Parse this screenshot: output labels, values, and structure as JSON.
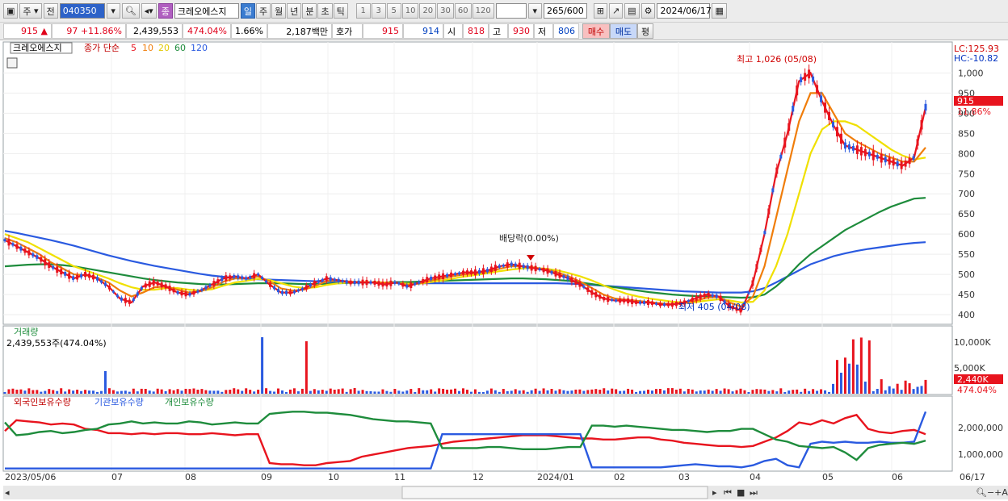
{
  "toolbar": {
    "period_unit": "주",
    "prev_label": "전",
    "code": "040350",
    "name_badge": "종",
    "name": "크레오에스지",
    "period_buttons": [
      "일",
      "주",
      "월",
      "년",
      "분",
      "초",
      "틱"
    ],
    "period_selected": "일",
    "num_buttons": [
      "1",
      "3",
      "5",
      "10",
      "20",
      "30",
      "60",
      "120"
    ],
    "count_display": "265/600",
    "date": "2024/06/17"
  },
  "quote": {
    "price": "915",
    "change": "97 +11.86%",
    "volume": "2,439,553",
    "volume_ratio": "474.04%",
    "turnover": "1.66%",
    "amount": "2,187백만",
    "hoga_label": "호가",
    "ask": "915",
    "bid": "914",
    "open_label": "시",
    "open": "818",
    "high_label": "고",
    "high": "930",
    "low_label": "저",
    "low": "806",
    "buy_label": "매수",
    "sell_label": "매도",
    "eval_label": "평"
  },
  "chart_data": [
    {
      "type": "line",
      "title": "크레오에스지",
      "subtitle": "종가 단순",
      "legend": [
        "5",
        "10",
        "20",
        "60",
        "120"
      ],
      "x_ticks": [
        "2023/05/06",
        "07",
        "08",
        "09",
        "10",
        "11",
        "12",
        "2024/01",
        "02",
        "03",
        "04",
        "05",
        "06",
        "06/17"
      ],
      "y_ticks": [
        400,
        450,
        500,
        550,
        600,
        650,
        700,
        750,
        800,
        850,
        900,
        950,
        1000
      ],
      "ylim": [
        380,
        1045
      ],
      "last_price": 915,
      "last_change": "11.86%",
      "lc_label": "LC:125.93",
      "hc_label": "HC:-10.82",
      "high_annotation": "최고 1,026 (05/08)",
      "low_annotation": "최저 405 (04/08)",
      "dividend_annotation": "배당락(0.00%)",
      "series": [
        {
          "name": "5",
          "color": "#e8141e",
          "values": [
            585,
            570,
            555,
            540,
            520,
            505,
            490,
            500,
            490,
            470,
            440,
            430,
            470,
            480,
            470,
            455,
            450,
            460,
            475,
            490,
            495,
            490,
            500,
            475,
            455,
            455,
            465,
            480,
            490,
            485,
            480,
            480,
            480,
            475,
            480,
            470,
            480,
            490,
            495,
            500,
            505,
            505,
            510,
            520,
            525,
            520,
            515,
            510,
            500,
            490,
            475,
            455,
            440,
            435,
            435,
            430,
            430,
            425,
            425,
            430,
            440,
            450,
            445,
            420,
            410,
            480,
            600,
            750,
            850,
            980,
            1000,
            930,
            870,
            820,
            810,
            800,
            790,
            780,
            770,
            790,
            915
          ]
        },
        {
          "name": "10",
          "color": "#f07d0a",
          "values": [
            590,
            580,
            565,
            550,
            530,
            515,
            500,
            498,
            492,
            480,
            460,
            445,
            455,
            468,
            470,
            462,
            455,
            458,
            468,
            482,
            490,
            490,
            495,
            483,
            465,
            460,
            462,
            472,
            484,
            485,
            482,
            481,
            480,
            478,
            479,
            474,
            477,
            485,
            490,
            496,
            500,
            503,
            506,
            514,
            520,
            520,
            517,
            512,
            505,
            495,
            482,
            466,
            450,
            440,
            437,
            434,
            431,
            428,
            426,
            428,
            434,
            442,
            444,
            430,
            420,
            445,
            520,
            640,
            760,
            880,
            950,
            950,
            900,
            850,
            830,
            815,
            800,
            790,
            780,
            780,
            815
          ]
        },
        {
          "name": "20",
          "color": "#f0e000",
          "values": [
            600,
            590,
            580,
            565,
            550,
            535,
            520,
            510,
            500,
            490,
            478,
            468,
            462,
            462,
            466,
            466,
            462,
            460,
            463,
            472,
            480,
            484,
            489,
            486,
            478,
            470,
            466,
            468,
            474,
            478,
            480,
            481,
            481,
            480,
            479,
            477,
            477,
            481,
            485,
            490,
            495,
            499,
            503,
            508,
            512,
            515,
            516,
            514,
            510,
            503,
            495,
            485,
            473,
            462,
            452,
            445,
            440,
            436,
            432,
            430,
            431,
            435,
            438,
            435,
            430,
            432,
            460,
            520,
            600,
            700,
            800,
            860,
            880,
            880,
            870,
            850,
            830,
            810,
            795,
            785,
            790
          ]
        },
        {
          "name": "60",
          "color": "#1e8c3c",
          "values": [
            520,
            522,
            524,
            525,
            525,
            523,
            520,
            515,
            510,
            505,
            500,
            495,
            490,
            486,
            483,
            480,
            478,
            476,
            475,
            475,
            476,
            477,
            478,
            478,
            478,
            477,
            476,
            476,
            477,
            478,
            479,
            480,
            480,
            480,
            481,
            481,
            482,
            483,
            484,
            485,
            486,
            487,
            488,
            489,
            490,
            490,
            489,
            488,
            486,
            484,
            480,
            476,
            472,
            468,
            464,
            460,
            456,
            453,
            450,
            448,
            446,
            445,
            444,
            443,
            442,
            443,
            450,
            470,
            495,
            525,
            550,
            570,
            590,
            610,
            625,
            640,
            655,
            668,
            678,
            688,
            690
          ]
        },
        {
          "name": "120",
          "color": "#2a5ae0",
          "values": [
            608,
            603,
            597,
            591,
            585,
            578,
            571,
            563,
            555,
            547,
            540,
            533,
            527,
            521,
            516,
            511,
            506,
            501,
            497,
            494,
            491,
            489,
            488,
            487,
            486,
            485,
            484,
            483,
            482,
            481,
            481,
            480,
            480,
            479,
            479,
            478,
            478,
            478,
            478,
            478,
            478,
            478,
            478,
            478,
            478,
            478,
            478,
            478,
            478,
            477,
            476,
            474,
            472,
            470,
            468,
            466,
            464,
            462,
            460,
            458,
            457,
            456,
            455,
            455,
            455,
            458,
            466,
            480,
            495,
            510,
            525,
            535,
            545,
            552,
            558,
            563,
            567,
            571,
            575,
            578,
            580
          ]
        }
      ]
    },
    {
      "type": "bar",
      "title": "거래량",
      "value_label": "2,439,553주(474.04%)",
      "y_ticks": [
        "5,000K",
        "10,000K"
      ],
      "last_value_label": "2,440K",
      "last_ratio_label": "474.04%"
    },
    {
      "type": "line",
      "legend": [
        "외국인보유수량",
        "기관보유수량",
        "개인보유수량"
      ],
      "y_ticks": [
        "1,000,000",
        "2,000,000"
      ],
      "ylim": [
        0,
        2900000
      ],
      "series": [
        {
          "name": "외국인보유수량",
          "color": "#e8141e",
          "values": [
            1800000,
            2300000,
            2250000,
            2200000,
            2100000,
            2150000,
            2100000,
            1900000,
            1850000,
            1700000,
            1700000,
            1650000,
            1700000,
            1650000,
            1700000,
            1700000,
            1650000,
            1650000,
            1700000,
            1650000,
            1600000,
            1650000,
            1650000,
            300000,
            250000,
            250000,
            200000,
            200000,
            300000,
            350000,
            400000,
            600000,
            700000,
            800000,
            900000,
            1000000,
            1050000,
            1100000,
            1200000,
            1300000,
            1350000,
            1400000,
            1450000,
            1500000,
            1550000,
            1600000,
            1600000,
            1600000,
            1550000,
            1500000,
            1450000,
            1450000,
            1400000,
            1400000,
            1450000,
            1500000,
            1500000,
            1400000,
            1350000,
            1250000,
            1200000,
            1150000,
            1100000,
            1100000,
            1050000,
            1100000,
            1300000,
            1500000,
            1800000,
            2200000,
            2100000,
            2300000,
            2150000,
            2400000,
            2550000,
            1900000,
            1750000,
            1700000,
            1800000,
            1850000,
            1650000
          ]
        },
        {
          "name": "기관보유수량",
          "color": "#2a5ae0",
          "values": [
            50000,
            50000,
            50000,
            50000,
            50000,
            50000,
            50000,
            50000,
            50000,
            50000,
            50000,
            50000,
            50000,
            50000,
            50000,
            50000,
            50000,
            50000,
            50000,
            50000,
            50000,
            50000,
            50000,
            50000,
            50000,
            50000,
            50000,
            50000,
            50000,
            50000,
            50000,
            50000,
            50000,
            50000,
            50000,
            50000,
            50000,
            50000,
            1650000,
            1650000,
            1650000,
            1650000,
            1650000,
            1650000,
            1650000,
            1650000,
            1650000,
            1650000,
            1650000,
            1650000,
            1650000,
            100000,
            100000,
            100000,
            100000,
            100000,
            100000,
            100000,
            150000,
            200000,
            250000,
            200000,
            150000,
            150000,
            100000,
            200000,
            400000,
            500000,
            200000,
            100000,
            1200000,
            1300000,
            1250000,
            1300000,
            1250000,
            1250000,
            1300000,
            1250000,
            1250000,
            1300000,
            2700000
          ]
        },
        {
          "name": "개인보유수량",
          "color": "#1e8c3c",
          "values": [
            2200000,
            1600000,
            1650000,
            1750000,
            1800000,
            1700000,
            1750000,
            1850000,
            1900000,
            2100000,
            2150000,
            2250000,
            2150000,
            2200000,
            2150000,
            2150000,
            2250000,
            2200000,
            2100000,
            2150000,
            2200000,
            2150000,
            2150000,
            2600000,
            2650000,
            2700000,
            2700000,
            2650000,
            2650000,
            2600000,
            2550000,
            2450000,
            2350000,
            2300000,
            2250000,
            2250000,
            2200000,
            2150000,
            1000000,
            1000000,
            1000000,
            1000000,
            1050000,
            1050000,
            1000000,
            950000,
            950000,
            950000,
            1000000,
            1050000,
            1050000,
            2050000,
            2050000,
            2000000,
            2050000,
            2000000,
            1950000,
            1900000,
            1850000,
            1850000,
            1800000,
            1750000,
            1800000,
            1800000,
            1900000,
            1900000,
            1650000,
            1400000,
            1300000,
            1100000,
            1050000,
            1000000,
            1050000,
            800000,
            450000,
            1000000,
            1150000,
            1200000,
            1250000,
            1200000,
            1350000
          ]
        }
      ]
    }
  ],
  "status_right": "06/17"
}
